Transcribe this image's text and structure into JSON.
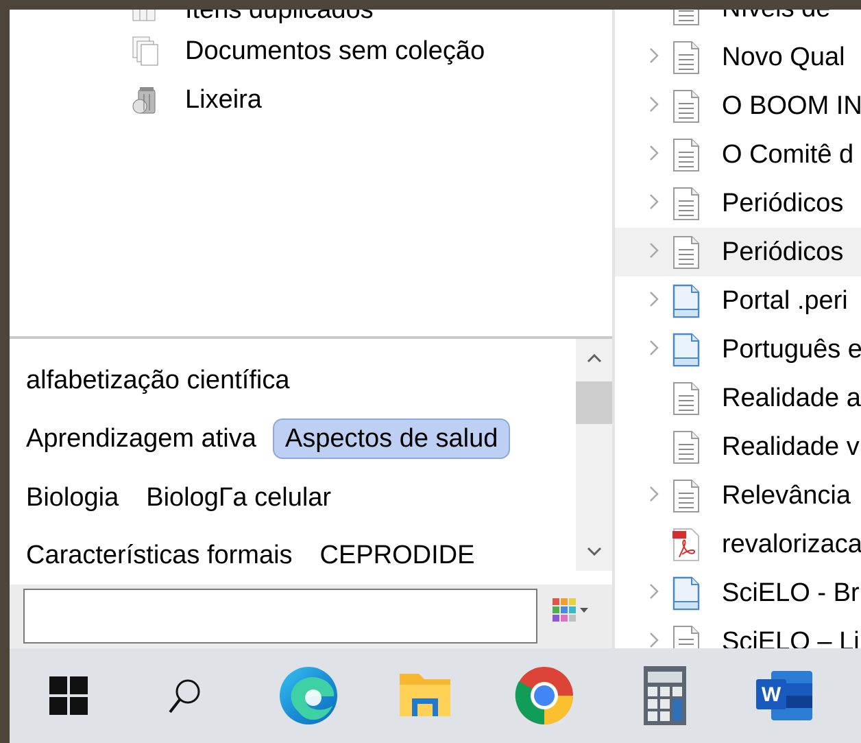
{
  "collections": {
    "partial_top_label": "Itens duplicados",
    "items": [
      {
        "label": "Documentos sem coleção",
        "icon": "unfiled-documents-icon"
      },
      {
        "label": "Lixeira",
        "icon": "trash-icon"
      }
    ]
  },
  "tag_selector": {
    "rows": [
      [
        "alfabetização científica"
      ],
      [
        "Aprendizagem ativa",
        "Aspectos de salud"
      ],
      [
        "Biologia",
        "BiologГa celular"
      ],
      [
        "Características formais",
        "CEPRODIDE"
      ]
    ],
    "selected_tag": "Aspectos de salud",
    "filter_value": ""
  },
  "items": [
    {
      "title": "Níveis de",
      "type": "document",
      "expandable": false
    },
    {
      "title": "Novo Qual",
      "type": "document",
      "expandable": true
    },
    {
      "title": "O BOOM IN",
      "type": "document",
      "expandable": true
    },
    {
      "title": "O Comitê d",
      "type": "document",
      "expandable": true
    },
    {
      "title": "Periódicos",
      "type": "document",
      "expandable": true
    },
    {
      "title": "Periódicos",
      "type": "document",
      "expandable": true,
      "highlighted": true
    },
    {
      "title": "Portal .peri",
      "type": "webpage",
      "expandable": true
    },
    {
      "title": "Português e",
      "type": "webpage",
      "expandable": true
    },
    {
      "title": "Realidade a",
      "type": "document",
      "expandable": false
    },
    {
      "title": "Realidade v",
      "type": "document",
      "expandable": false
    },
    {
      "title": "Relevância",
      "type": "document",
      "expandable": true
    },
    {
      "title": "revalorizaca",
      "type": "pdf",
      "expandable": false
    },
    {
      "title": "SciELO - Br",
      "type": "webpage",
      "expandable": true
    },
    {
      "title": "SciELO – Li",
      "type": "document",
      "expandable": true
    }
  ],
  "taskbar": [
    {
      "name": "start-button",
      "icon": "windows-logo-icon",
      "running": false
    },
    {
      "name": "search-button",
      "icon": "search-icon",
      "running": false
    },
    {
      "name": "edge-button",
      "icon": "edge-icon",
      "running": false
    },
    {
      "name": "file-explorer-button",
      "icon": "folder-icon",
      "running": false
    },
    {
      "name": "chrome-button",
      "icon": "chrome-icon",
      "running": false
    },
    {
      "name": "calculator-button",
      "icon": "calculator-icon",
      "running": false
    },
    {
      "name": "word-button",
      "icon": "word-icon",
      "running": false
    }
  ],
  "colors": {
    "desktop_frame": "#4d443a",
    "tag_selected_bg": "#bdd0f3",
    "taskbar_bg": "#dfe3e8",
    "running_indicator": "#4ea4d8"
  }
}
